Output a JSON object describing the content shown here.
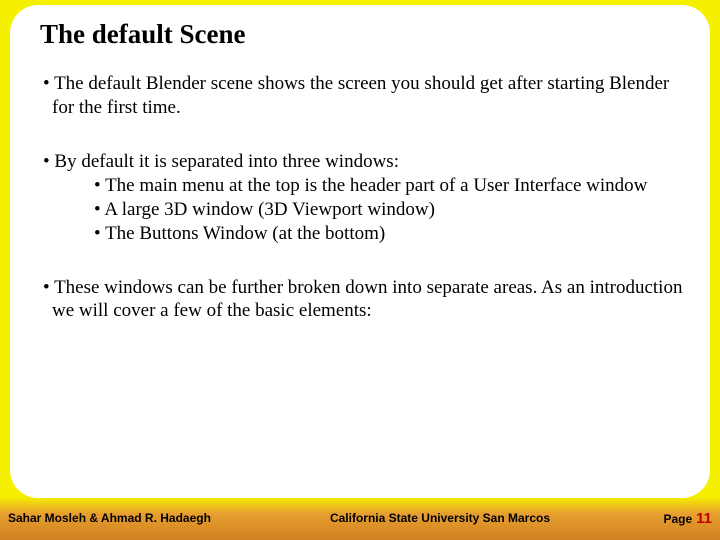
{
  "slide": {
    "title": "The default Scene",
    "bullets": [
      {
        "text": "The default Blender scene shows the screen you should get after starting Blender for the first time."
      },
      {
        "text": "By default it is separated into three windows:",
        "subs": [
          "The main menu at the top is the header part of a User Interface window",
          "A large 3D window (3D Viewport window)",
          "The Buttons Window (at the bottom)"
        ]
      },
      {
        "text": "These windows can be further broken down into separate areas. As an introduction we will cover a few of the basic elements:"
      }
    ]
  },
  "footer": {
    "authors": "Sahar Mosleh & Ahmad R. Hadaegh",
    "institution": "California State University San Marcos",
    "page_label": "Page",
    "page_number": "11"
  }
}
